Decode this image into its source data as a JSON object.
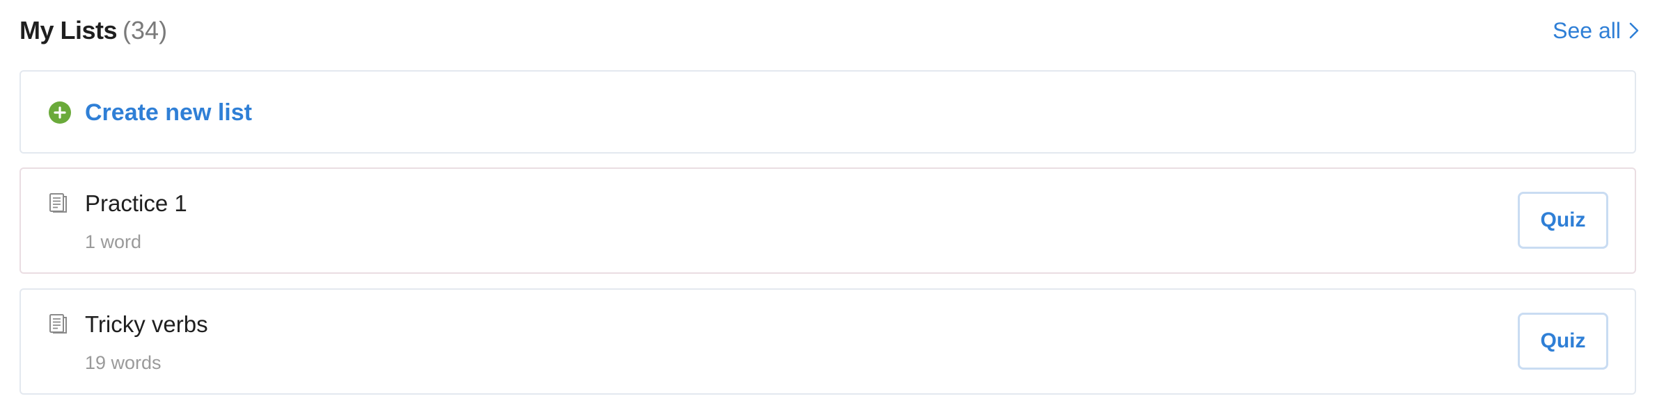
{
  "header": {
    "title": "My Lists",
    "count": "(34)",
    "see_all_label": "See all",
    "see_all_icon": "chevron-right-icon"
  },
  "create": {
    "label": "Create new list",
    "icon": "plus-circle-icon",
    "icon_color": "#6aaa3a"
  },
  "lists": [
    {
      "name": "Practice 1",
      "meta": "1 word",
      "icon": "document-icon",
      "action_label": "Quiz"
    },
    {
      "name": "Tricky verbs",
      "meta": "19 words",
      "icon": "document-icon",
      "action_label": "Quiz"
    }
  ],
  "colors": {
    "accent": "#2f7fd6",
    "muted_text": "#9a9a9a",
    "card_border": "#e3e8ef",
    "quiz_border": "#c9dcf2",
    "plus_green": "#6aaa3a"
  }
}
